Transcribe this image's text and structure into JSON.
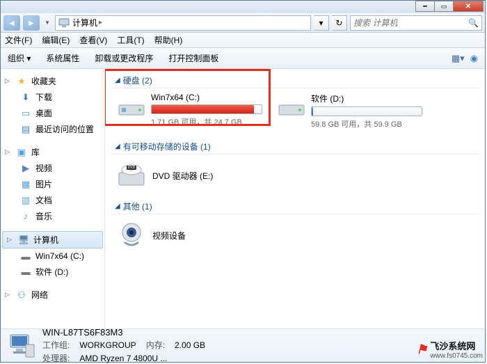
{
  "nav": {
    "location": "计算机",
    "search_placeholder": "搜索 计算机"
  },
  "menu": {
    "file": "文件(F)",
    "edit": "编辑(E)",
    "view": "查看(V)",
    "tools": "工具(T)",
    "help": "帮助(H)"
  },
  "toolbar": {
    "organize": "组织 ▾",
    "sys_props": "系统属性",
    "uninstall": "卸载或更改程序",
    "control_panel": "打开控制面板"
  },
  "sidebar": {
    "favorites": {
      "label": "收藏夹",
      "items": [
        {
          "label": "下载",
          "icon": "download-icon"
        },
        {
          "label": "桌面",
          "icon": "desktop-icon"
        },
        {
          "label": "最近访问的位置",
          "icon": "recent-icon"
        }
      ]
    },
    "libraries": {
      "label": "库",
      "items": [
        {
          "label": "视频",
          "icon": "video-icon"
        },
        {
          "label": "图片",
          "icon": "pictures-icon"
        },
        {
          "label": "文档",
          "icon": "documents-icon"
        },
        {
          "label": "音乐",
          "icon": "music-icon"
        }
      ]
    },
    "computer": {
      "label": "计算机",
      "items": [
        {
          "label": "Win7x64 (C:)",
          "icon": "drive-icon"
        },
        {
          "label": "软件 (D:)",
          "icon": "drive-icon"
        }
      ]
    },
    "network": {
      "label": "网络"
    }
  },
  "sections": {
    "hdd": {
      "title": "硬盘 (2)",
      "drives": [
        {
          "name": "Win7x64 (C:)",
          "free_text": "1.71 GB 可用，共 24.7 GB",
          "fill_pct": 93,
          "fill_color": "red"
        },
        {
          "name": "软件 (D:)",
          "free_text": "59.8 GB 可用，共 59.9 GB",
          "fill_pct": 1,
          "fill_color": "blue"
        }
      ]
    },
    "removable": {
      "title": "有可移动存储的设备 (1)",
      "items": [
        {
          "name": "DVD 驱动器 (E:)"
        }
      ]
    },
    "other": {
      "title": "其他 (1)",
      "items": [
        {
          "name": "视频设备"
        }
      ]
    }
  },
  "details": {
    "name": "WIN-L87TS6F83M3",
    "workgroup_label": "工作组:",
    "workgroup": "WORKGROUP",
    "memory_label": "内存:",
    "memory": "2.00 GB",
    "cpu_label": "处理器:",
    "cpu": "AMD Ryzen 7 4800U ..."
  },
  "watermark": {
    "text": "飞沙系统网",
    "url": "www.fs0745.com"
  }
}
